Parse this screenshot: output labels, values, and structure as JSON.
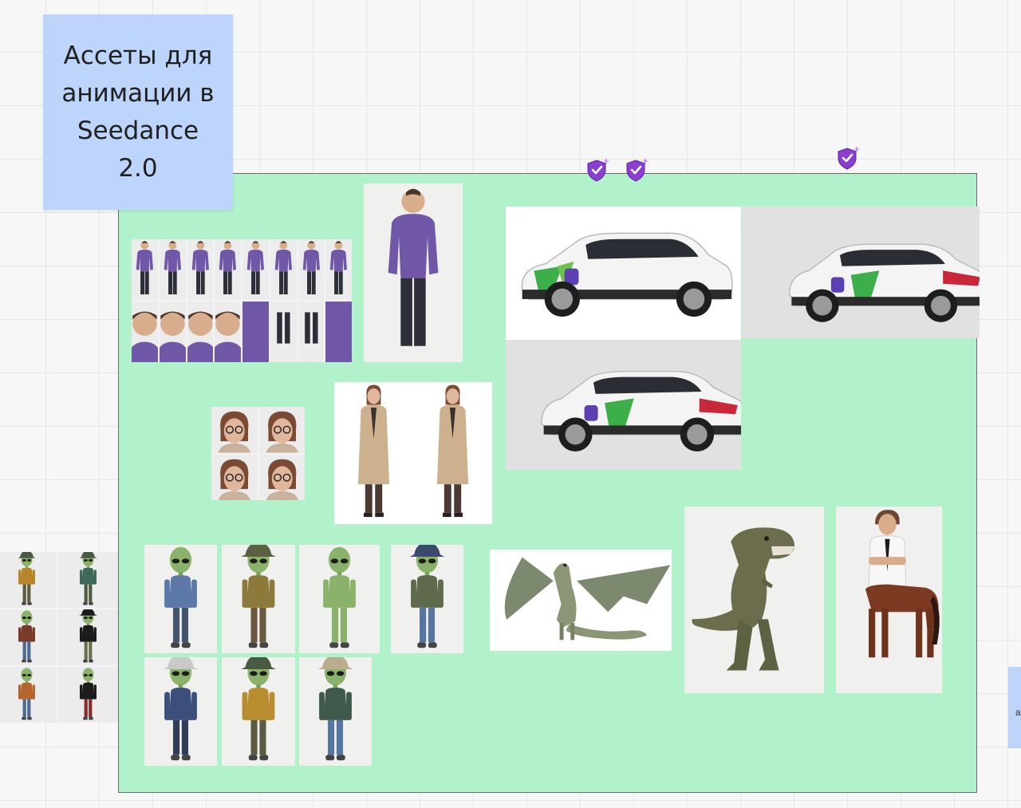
{
  "board": {
    "sticky_note": {
      "text": "Ассеты для\nанимации в\nSeedance\n2.0"
    },
    "side_note": {
      "text": "a"
    },
    "colors": {
      "canvas": "#f7f7f7",
      "sticky": "#bdd5fb",
      "frame": "#b1f2ca",
      "badge": "#8a3fd1"
    },
    "badges": [
      {
        "icon": "verified-shield-icon"
      },
      {
        "icon": "verified-shield-icon"
      },
      {
        "icon": "verified-shield-icon"
      }
    ],
    "assets": [
      {
        "name": "man-purple-sweater-turnaround-sheet",
        "icon": "man-purple-sweater-image"
      },
      {
        "name": "man-purple-sweater-full-body",
        "icon": "man-purple-sweater-image"
      },
      {
        "name": "woman-face-expressions-sheet",
        "icon": "woman-face-image"
      },
      {
        "name": "woman-trench-coat-front-back",
        "icon": "woman-trench-coat-image"
      },
      {
        "name": "white-suv-front-side",
        "icon": "suv-car-image"
      },
      {
        "name": "white-suv-rear-three-quarter",
        "icon": "suv-car-image"
      },
      {
        "name": "white-suv-rear-side",
        "icon": "suv-car-image"
      },
      {
        "name": "alien-denim-jacket",
        "icon": "alien-character-image"
      },
      {
        "name": "alien-bucket-hat-colorful-jacket",
        "icon": "alien-character-image"
      },
      {
        "name": "alien-plain-green",
        "icon": "alien-character-image"
      },
      {
        "name": "alien-cap-jacket",
        "icon": "alien-character-image"
      },
      {
        "name": "alien-silver-hat-denim",
        "icon": "alien-character-image"
      },
      {
        "name": "alien-bucket-hat-mustard-jacket",
        "icon": "alien-character-image"
      },
      {
        "name": "alien-beanie-jacket",
        "icon": "alien-character-image"
      },
      {
        "name": "alien-variations-sheet",
        "icon": "alien-character-image"
      },
      {
        "name": "winged-dragon",
        "icon": "dragon-image"
      },
      {
        "name": "tyrannosaurus-rex",
        "icon": "dinosaur-image"
      },
      {
        "name": "centaur-boy-horse",
        "icon": "centaur-image"
      }
    ]
  }
}
